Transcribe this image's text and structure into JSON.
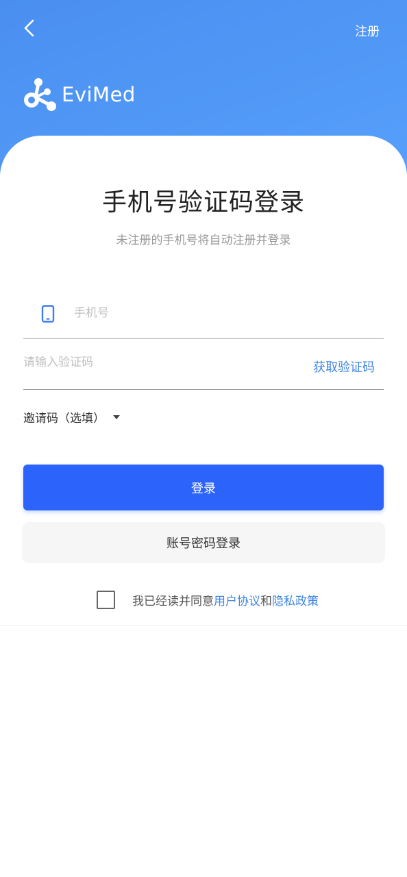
{
  "header": {
    "register_label": "注册",
    "logo_text": "EviMed"
  },
  "main": {
    "title": "手机号验证码登录",
    "subtitle": "未注册的手机号将自动注册并登录",
    "phone_placeholder": "手机号",
    "phone_value": "",
    "code_placeholder": "请输入验证码",
    "code_value": "",
    "get_code_label": "获取验证码",
    "invite_label": "邀请码（选填）",
    "login_label": "登录",
    "password_login_label": "账号密码登录"
  },
  "agreement": {
    "prefix": "我已经读并同意",
    "user_agreement": "用户协议",
    "conjunction": "和",
    "privacy_policy": "隐私政策",
    "checked": false
  },
  "colors": {
    "header_gradient_start": "#4a8ff0",
    "header_gradient_end": "#57a0fb",
    "primary_button": "#2c63fa",
    "link": "#3f86e0",
    "icon_blue": "#3e7cf5"
  },
  "icons": {
    "back": "chevron-left-icon",
    "logo": "molecule-logo-icon",
    "phone": "mobile-phone-icon",
    "dropdown": "caret-down-icon",
    "checkbox": "checkbox-icon"
  }
}
